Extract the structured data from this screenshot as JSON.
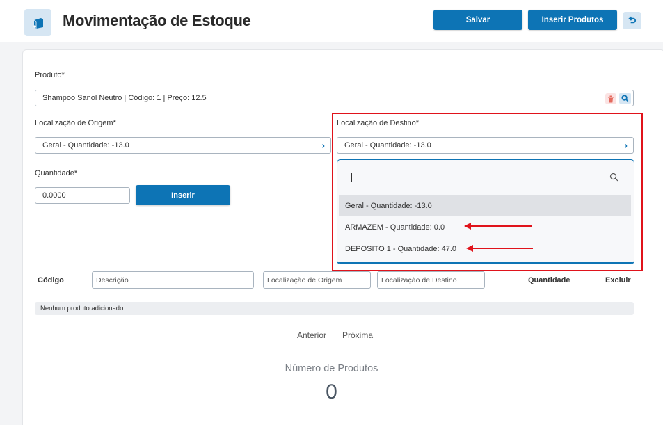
{
  "header": {
    "title": "Movimentação de Estoque",
    "save_label": "Salvar",
    "insert_products_label": "Inserir Produtos"
  },
  "form": {
    "product_label": "Produto*",
    "product_value": "Shampoo Sanol Neutro | Código: 1 | Preço: 12.5",
    "origin_label": "Localização de Origem*",
    "origin_value": "Geral - Quantidade: -13.0",
    "destination_label": "Localização de Destino*",
    "destination_value": "Geral - Quantidade: -13.0",
    "quantity_label": "Quantidade*",
    "quantity_value": "0.0000",
    "insert_label": "Inserir"
  },
  "dropdown": {
    "options": [
      "Geral - Quantidade: -13.0",
      "ARMAZEM - Quantidade: 0.0",
      "DEPOSITO 1 - Quantidade: 47.0"
    ],
    "selected_index": 0
  },
  "table": {
    "col_codigo": "Código",
    "filter_descricao": "Descrição",
    "filter_origem": "Localização de Origem",
    "filter_destino": "Localização de Destino",
    "col_quantidade": "Quantidade",
    "col_excluir": "Excluir",
    "empty_message": "Nenhum produto adicionado"
  },
  "pagination": {
    "previous": "Anterior",
    "next": "Próxima"
  },
  "summary": {
    "label": "Número de Produtos",
    "value": "0"
  },
  "colors": {
    "primary": "#0d74b5",
    "annotation": "#e0131b"
  }
}
